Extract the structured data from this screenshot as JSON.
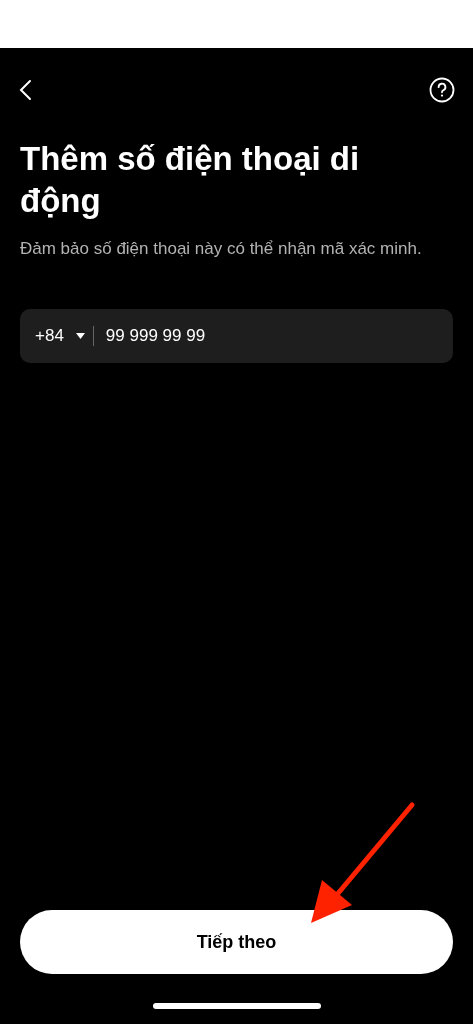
{
  "title": "Thêm số điện thoại di động",
  "subtitle": "Đảm bảo số điện thoại này có thể nhận mã xác minh.",
  "phone_field": {
    "country_code": "+84",
    "value": "99 999 99 99"
  },
  "next_button": {
    "label": "Tiếp theo"
  }
}
